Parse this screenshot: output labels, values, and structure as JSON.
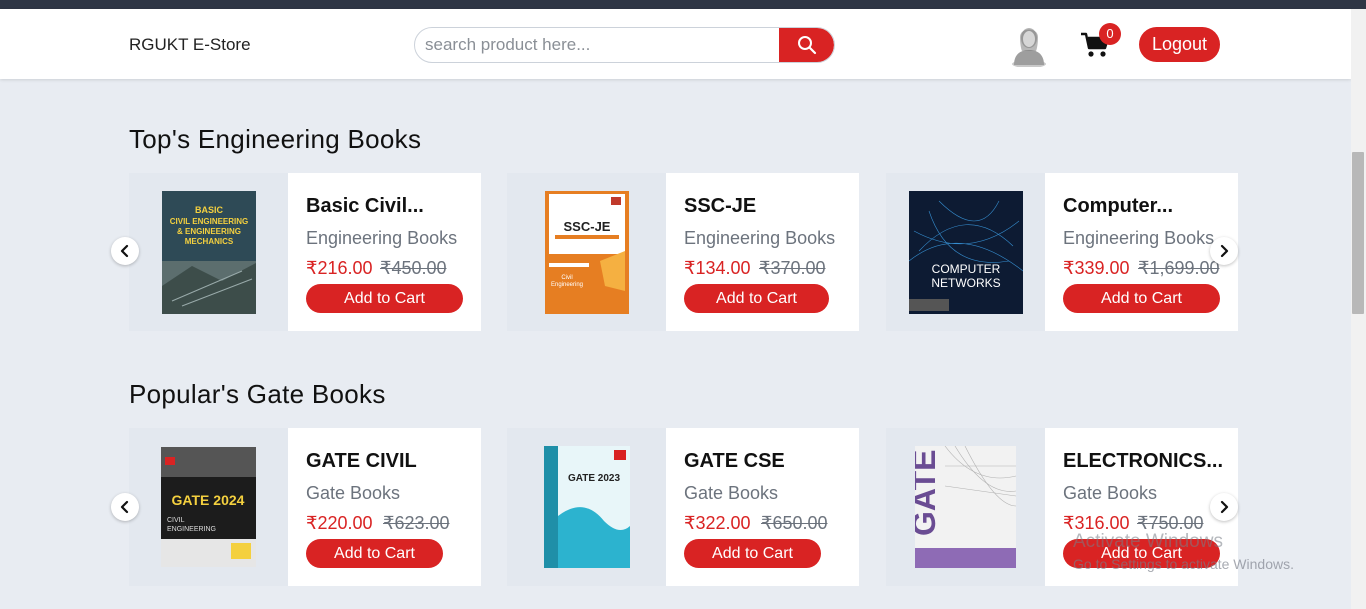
{
  "navbar": {
    "brand": "RGUKT E-Store",
    "search_placeholder": "search product here...",
    "cart_count": "0",
    "logout_label": "Logout",
    "icons": [
      "search-icon",
      "user-avatar-icon",
      "cart-icon"
    ]
  },
  "colors": {
    "accent": "#d92323",
    "page_bg": "#e8ecf2",
    "top_strip": "#2f3645"
  },
  "sections": [
    {
      "title": "Top's Engineering Books",
      "products": [
        {
          "title": "Basic Civil...",
          "category": "Engineering Books",
          "price": "₹216.00",
          "mrp": "₹450.00",
          "button": "Add to Cart",
          "cover_text": "BASIC CIVIL ENGINEERING & ENGINEERING MECHANICS"
        },
        {
          "title": "SSC-JE",
          "category": "Engineering Books",
          "price": "₹134.00",
          "mrp": "₹370.00",
          "button": "Add to Cart",
          "cover_text": "SSC-JE"
        },
        {
          "title": "Computer...",
          "category": "Engineering Books",
          "price": "₹339.00",
          "mrp": "₹1,699.00",
          "button": "Add to Cart",
          "cover_text": "COMPUTER NETWORKS"
        }
      ]
    },
    {
      "title": "Popular's Gate Books",
      "products": [
        {
          "title": "GATE CIVIL",
          "category": "Gate Books",
          "price": "₹220.00",
          "mrp": "₹623.00",
          "button": "Add to Cart",
          "cover_text": "GATE 2024"
        },
        {
          "title": "GATE CSE",
          "category": "Gate Books",
          "price": "₹322.00",
          "mrp": "₹650.00",
          "button": "Add to Cart",
          "cover_text": "GATE 2023"
        },
        {
          "title": "ELECTRONICS...",
          "category": "Gate Books",
          "price": "₹316.00",
          "mrp": "₹750.00",
          "button": "Add to Cart",
          "cover_text": "GATE"
        }
      ]
    }
  ],
  "watermark": {
    "line1": "Activate Windows",
    "line2": "Go to Settings to activate Windows."
  }
}
